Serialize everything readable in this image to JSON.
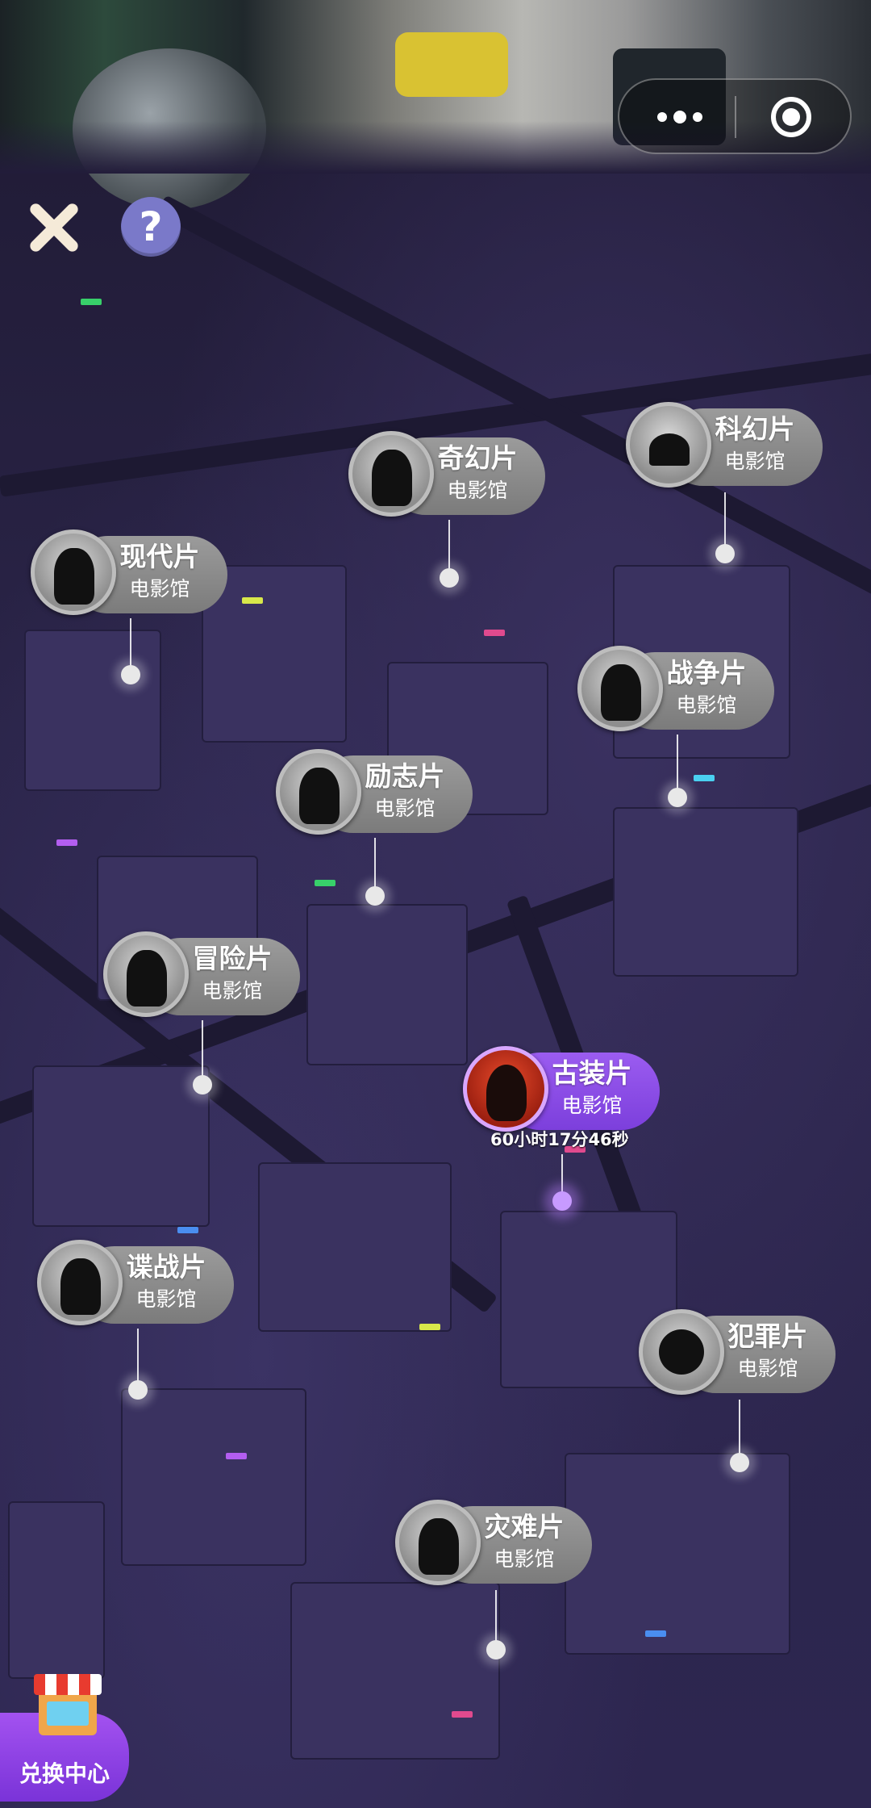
{
  "top_controls": {
    "more_icon": "more-dots-icon",
    "close_icon": "target-circle-icon"
  },
  "map": {
    "help_label": "?",
    "halls": [
      {
        "id": "fantasy",
        "name": "奇幻片",
        "sub": "电影馆",
        "state": "normal"
      },
      {
        "id": "scifi",
        "name": "科幻片",
        "sub": "电影馆",
        "state": "normal"
      },
      {
        "id": "modern",
        "name": "现代片",
        "sub": "电影馆",
        "state": "normal"
      },
      {
        "id": "war",
        "name": "战争片",
        "sub": "电影馆",
        "state": "normal"
      },
      {
        "id": "inspire",
        "name": "励志片",
        "sub": "电影馆",
        "state": "normal"
      },
      {
        "id": "adventure",
        "name": "冒险片",
        "sub": "电影馆",
        "state": "normal"
      },
      {
        "id": "costume",
        "name": "古装片",
        "sub": "电影馆",
        "state": "active",
        "timer": "60小时17分46秒"
      },
      {
        "id": "spy",
        "name": "谍战片",
        "sub": "电影馆",
        "state": "normal"
      },
      {
        "id": "crime",
        "name": "犯罪片",
        "sub": "电影馆",
        "state": "normal"
      },
      {
        "id": "disaster",
        "name": "灾难片",
        "sub": "电影馆",
        "state": "normal"
      }
    ]
  },
  "exchange": {
    "label": "兑换中心"
  },
  "colors": {
    "active_accent": "#8a47e6",
    "pill_gray": "#8a8a8a",
    "background": "#2a2448"
  }
}
